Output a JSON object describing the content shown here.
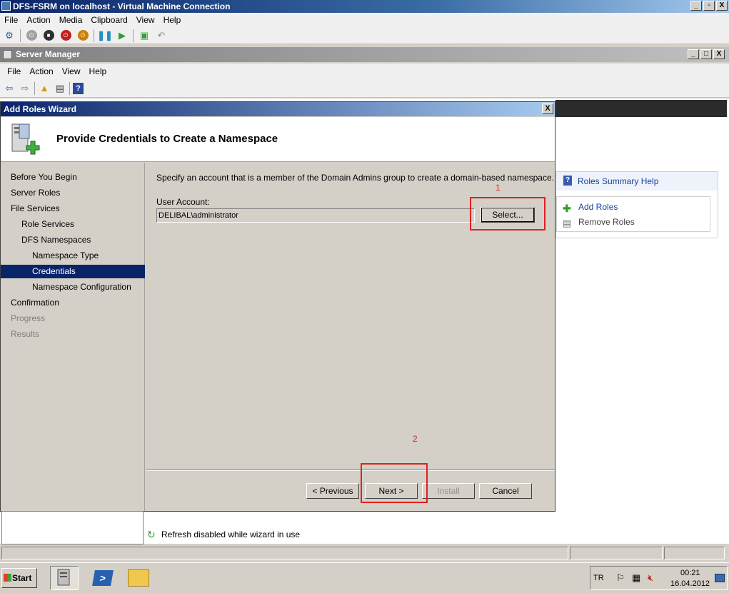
{
  "vm_window": {
    "title": "DFS-FSRM on localhost - Virtual Machine Connection",
    "menu": [
      "File",
      "Action",
      "Media",
      "Clipboard",
      "View",
      "Help"
    ],
    "controls": [
      "_",
      "▫",
      "X"
    ]
  },
  "server_manager": {
    "title": "Server Manager",
    "menu": [
      "File",
      "Action",
      "View",
      "Help"
    ],
    "controls": [
      "_",
      "□",
      "X"
    ]
  },
  "right_panel": {
    "header": "Roles Summary Help",
    "items": [
      "Add Roles",
      "Remove Roles"
    ]
  },
  "wizard": {
    "title": "Add Roles Wizard",
    "close": "X",
    "heading": "Provide Credentials to Create a Namespace",
    "nav": [
      {
        "label": "Before You Begin",
        "indent": 0,
        "state": "normal"
      },
      {
        "label": "Server Roles",
        "indent": 0,
        "state": "normal"
      },
      {
        "label": "File Services",
        "indent": 0,
        "state": "normal"
      },
      {
        "label": "Role Services",
        "indent": 1,
        "state": "normal"
      },
      {
        "label": "DFS Namespaces",
        "indent": 1,
        "state": "normal"
      },
      {
        "label": "Namespace Type",
        "indent": 2,
        "state": "normal"
      },
      {
        "label": "Credentials",
        "indent": 2,
        "state": "selected"
      },
      {
        "label": "Namespace Configuration",
        "indent": 2,
        "state": "normal"
      },
      {
        "label": "Confirmation",
        "indent": 0,
        "state": "normal"
      },
      {
        "label": "Progress",
        "indent": 0,
        "state": "disabled"
      },
      {
        "label": "Results",
        "indent": 0,
        "state": "disabled"
      }
    ],
    "description": "Specify an account that is a member of the Domain Admins group to create a domain-based namespace.",
    "user_account_label": "User Account:",
    "user_account_value": "DELIBAL\\administrator",
    "select_button": "Select...",
    "previous_button": "< Previous",
    "next_button": "Next >",
    "install_button": "Install",
    "cancel_button": "Cancel",
    "annotation_1": "1",
    "annotation_2": "2"
  },
  "status": {
    "refresh_text": "Refresh disabled while wizard in use"
  },
  "taskbar": {
    "start_label": "Start",
    "language": "TR",
    "time": "00:21",
    "date": "16.04.2012"
  },
  "colors": {
    "selection": "#0a246a",
    "annotation": "#e02020",
    "link": "#15419c"
  }
}
